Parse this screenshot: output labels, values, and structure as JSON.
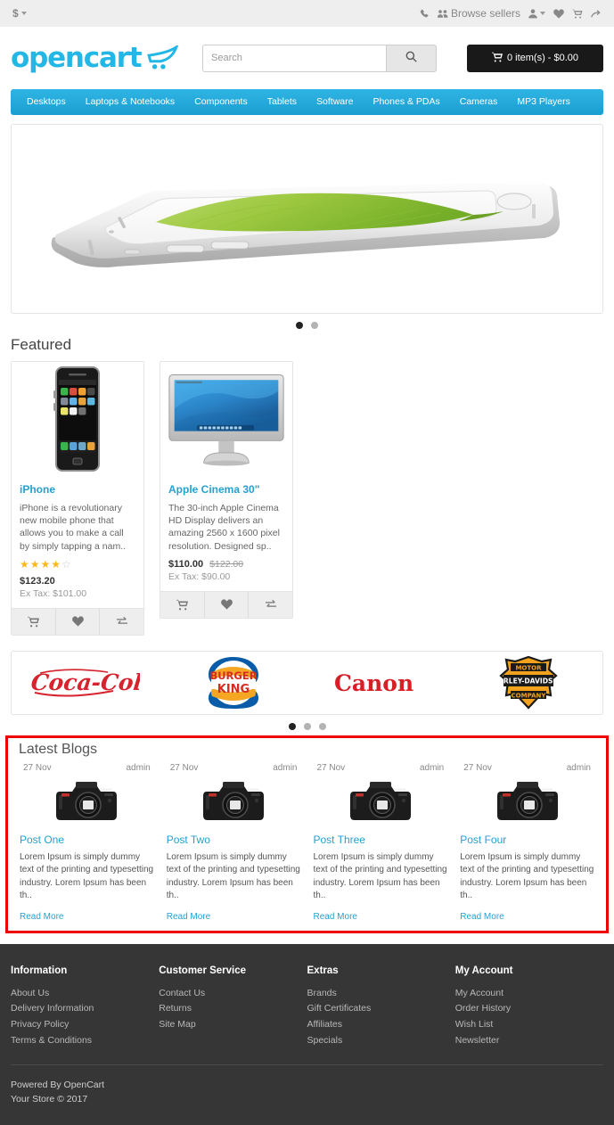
{
  "topbar": {
    "currency_symbol": "$",
    "phone_icon": "phone-icon",
    "browse_sellers_label": "Browse sellers",
    "sellers_icon": "users-icon",
    "account_icon": "user-icon",
    "wishlist_icon": "heart-icon",
    "cart_icon": "cart-icon",
    "checkout_icon": "share-arrow-icon"
  },
  "header": {
    "logo_text": "opencart",
    "logo_icon": "shopping-cart-swoosh-icon",
    "search_placeholder": "Search",
    "search_value": "",
    "search_icon": "search-icon",
    "cart_label": "0 item(s) - $0.00",
    "cart_icon": "cart-icon"
  },
  "nav": {
    "items": [
      {
        "label": "Desktops"
      },
      {
        "label": "Laptops & Notebooks"
      },
      {
        "label": "Components"
      },
      {
        "label": "Tablets"
      },
      {
        "label": "Software"
      },
      {
        "label": "Phones & PDAs"
      },
      {
        "label": "Cameras"
      },
      {
        "label": "MP3 Players"
      }
    ]
  },
  "hero": {
    "alt": "iphone6-banner",
    "dots": [
      {
        "active": true
      },
      {
        "active": false
      }
    ]
  },
  "featured": {
    "title": "Featured",
    "products": [
      {
        "name": "iPhone",
        "image": "iphone-thumbnail",
        "description": "iPhone is a revolutionary new mobile phone that allows you to make a call by simply tapping a nam..",
        "rating": 4,
        "rating_max": 5,
        "has_rating": true,
        "price": "$123.20",
        "price_old": "",
        "tax": "Ex Tax: $101.00",
        "actions": {
          "cart": "cart-icon",
          "wishlist": "heart-icon",
          "compare": "compare-icon"
        }
      },
      {
        "name": "Apple Cinema 30\"",
        "image": "apple-cinema-display-thumbnail",
        "description": "The 30-inch Apple Cinema HD Display delivers an amazing 2560 x 1600 pixel resolution. Designed sp..",
        "rating": 0,
        "rating_max": 5,
        "has_rating": false,
        "price": "$110.00",
        "price_old": "$122.00",
        "tax": "Ex Tax: $90.00",
        "actions": {
          "cart": "cart-icon",
          "wishlist": "heart-icon",
          "compare": "compare-icon"
        }
      }
    ]
  },
  "brands": {
    "items": [
      {
        "name": "Coca Cola"
      },
      {
        "name": "Burger King"
      },
      {
        "name": "Canon"
      },
      {
        "name": "Harley Davidson"
      }
    ],
    "dots": [
      {
        "active": true
      },
      {
        "active": false
      },
      {
        "active": false
      }
    ]
  },
  "blogs": {
    "title": "Latest Blogs",
    "highlight_color": "#ef0000",
    "posts": [
      {
        "date": "27 Nov",
        "author": "admin",
        "image": "dslr-camera-thumbnail",
        "title": "Post One",
        "excerpt": "Lorem Ipsum is simply dummy text of the printing and typesetting industry. Lorem Ipsum has been th..",
        "read_more": "Read More"
      },
      {
        "date": "27 Nov",
        "author": "admin",
        "image": "dslr-camera-thumbnail",
        "title": "Post Two",
        "excerpt": "Lorem Ipsum is simply dummy text of the printing and typesetting industry. Lorem Ipsum has been th..",
        "read_more": "Read More"
      },
      {
        "date": "27 Nov",
        "author": "admin",
        "image": "dslr-camera-thumbnail",
        "title": "Post Three",
        "excerpt": "Lorem Ipsum is simply dummy text of the printing and typesetting industry. Lorem Ipsum has been th..",
        "read_more": "Read More"
      },
      {
        "date": "27 Nov",
        "author": "admin",
        "image": "dslr-camera-thumbnail",
        "title": "Post Four",
        "excerpt": "Lorem Ipsum is simply dummy text of the printing and typesetting industry. Lorem Ipsum has been th..",
        "read_more": "Read More"
      }
    ]
  },
  "footer": {
    "columns": [
      {
        "heading": "Information",
        "links": [
          {
            "label": "About Us"
          },
          {
            "label": "Delivery Information"
          },
          {
            "label": "Privacy Policy"
          },
          {
            "label": "Terms & Conditions"
          }
        ]
      },
      {
        "heading": "Customer Service",
        "links": [
          {
            "label": "Contact Us"
          },
          {
            "label": "Returns"
          },
          {
            "label": "Site Map"
          }
        ]
      },
      {
        "heading": "Extras",
        "links": [
          {
            "label": "Brands"
          },
          {
            "label": "Gift Certificates"
          },
          {
            "label": "Affiliates"
          },
          {
            "label": "Specials"
          }
        ]
      },
      {
        "heading": "My Account",
        "links": [
          {
            "label": "My Account"
          },
          {
            "label": "Order History"
          },
          {
            "label": "Wish List"
          },
          {
            "label": "Newsletter"
          }
        ]
      }
    ],
    "powered_by_prefix": "Powered By ",
    "powered_by_link": "OpenCart",
    "copyright": "Your Store © 2017"
  },
  "colors": {
    "brand_cyan": "#23a1d1",
    "topbar_bg": "#eeeeee",
    "footer_bg": "#363636",
    "highlight_red": "#ef0000",
    "star_gold": "#fcb71b"
  }
}
